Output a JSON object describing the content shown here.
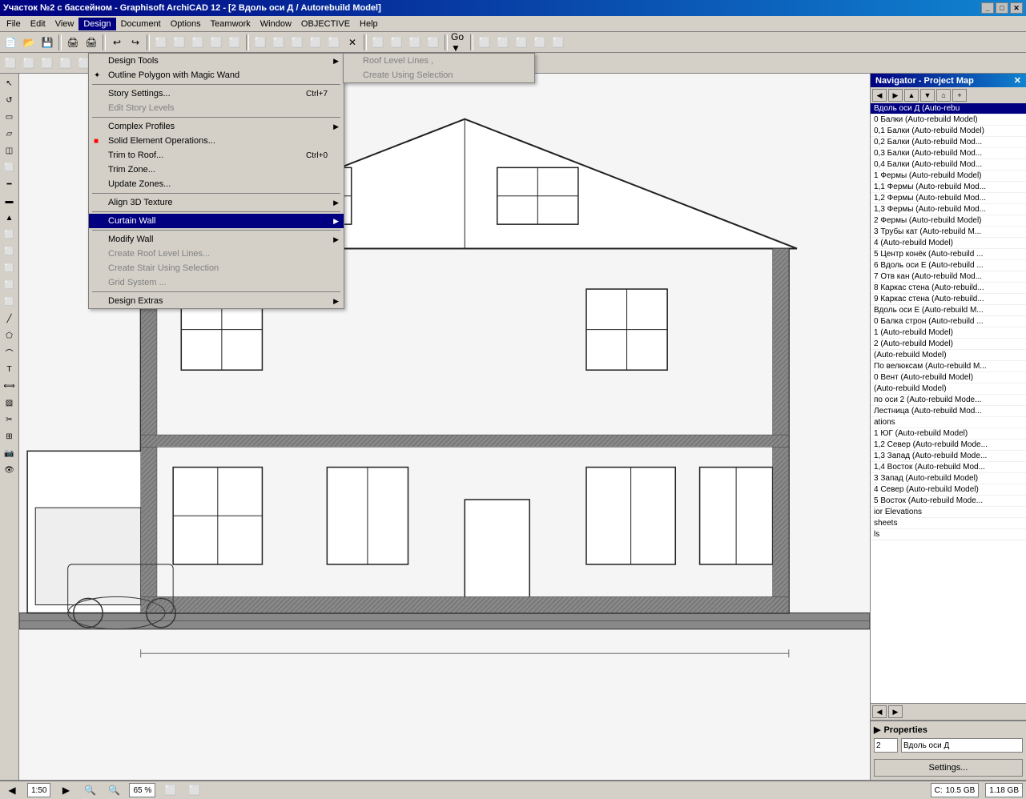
{
  "window": {
    "title": "Участок №2 с бассейном - Graphisoft ArchiCAD 12 - [2 Вдоль оси Д / Autorebuild Model]",
    "title_buttons": [
      "_",
      "□",
      "✕"
    ]
  },
  "menubar": {
    "items": [
      "File",
      "Edit",
      "View",
      "Design",
      "Document",
      "Options",
      "Teamwork",
      "Window",
      "OBJECTIVE",
      "Help"
    ]
  },
  "design_menu": {
    "items": [
      {
        "label": "Design Tools",
        "has_submenu": true,
        "disabled": false,
        "icon": ""
      },
      {
        "label": "Outline Polygon with Magic Wand",
        "has_submenu": false,
        "disabled": false,
        "icon": "✦"
      },
      {
        "label": "---"
      },
      {
        "label": "Story Settings...",
        "shortcut": "Ctrl+7",
        "has_submenu": false,
        "disabled": false,
        "icon": ""
      },
      {
        "label": "Edit Story Levels",
        "has_submenu": false,
        "disabled": true,
        "icon": ""
      },
      {
        "label": "---"
      },
      {
        "label": "Complex Profiles",
        "has_submenu": true,
        "disabled": false,
        "icon": ""
      },
      {
        "label": "Solid Element Operations...",
        "has_submenu": false,
        "disabled": false,
        "icon": "■"
      },
      {
        "label": "Trim to Roof...",
        "shortcut": "Ctrl+0",
        "has_submenu": false,
        "disabled": false,
        "icon": ""
      },
      {
        "label": "Trim Zone...",
        "has_submenu": false,
        "disabled": false,
        "icon": ""
      },
      {
        "label": "Update Zones...",
        "has_submenu": false,
        "disabled": false,
        "icon": ""
      },
      {
        "label": "---"
      },
      {
        "label": "Align 3D Texture",
        "has_submenu": true,
        "disabled": false,
        "icon": ""
      },
      {
        "label": "---"
      },
      {
        "label": "Curtain Wall",
        "has_submenu": true,
        "disabled": false,
        "icon": "",
        "hovered": true
      },
      {
        "label": "---"
      },
      {
        "label": "Modify Wall",
        "has_submenu": true,
        "disabled": false,
        "icon": ""
      },
      {
        "label": "Create Roof Level Lines...",
        "has_submenu": false,
        "disabled": true,
        "icon": ""
      },
      {
        "label": "Create Stair Using Selection",
        "has_submenu": false,
        "disabled": true,
        "icon": ""
      },
      {
        "label": "Grid System ...",
        "has_submenu": false,
        "disabled": true,
        "icon": ""
      },
      {
        "label": "---"
      },
      {
        "label": "Design Extras",
        "has_submenu": true,
        "disabled": false,
        "icon": ""
      }
    ]
  },
  "curtain_wall_submenu": {
    "items": [
      {
        "label": "Roof Level Lines   ,",
        "disabled": true
      },
      {
        "label": "Create Using Selection",
        "disabled": true
      }
    ]
  },
  "navigator": {
    "title": "Navigator - Project Map",
    "items": [
      "Вдоль оси Д (Auto-rebu",
      "0 Балки (Auto-rebuild Model)",
      "0,1 Балки (Auto-rebuild Model)",
      "0,2 Балки (Auto-rebuild Mod...",
      "0,3 Балки (Auto-rebuild Mod...",
      "0,4 Балки (Auto-rebuild Mod...",
      "1 Фермы (Auto-rebuild Model)",
      "1,1 Фермы (Auto-rebuild Mod...",
      "1,2 Фермы (Auto-rebuild Mod...",
      "1,3 Фермы (Auto-rebuild Mod...",
      "2 Фермы (Auto-rebuild Model)",
      "3 Трубы кат (Auto-rebuild M...",
      "4 (Auto-rebuild Model)",
      "5 Центр конёк (Auto-rebuild ...",
      "6 Вдоль оси Е (Auto-rebuild ...",
      "7 Отв кан (Auto-rebuild Mod...",
      "8 Каркас стена (Auto-rebuild...",
      "9 Каркас стена (Auto-rebuild...",
      "Вдоль оси Е (Auto-rebuild M...",
      "0 Балка строн (Auto-rebuild ...",
      "1 (Auto-rebuild Model)",
      "2 (Auto-rebuild Model)",
      "(Auto-rebuild Model)",
      "По велюксам (Auto-rebuild M...",
      "0 Вент (Auto-rebuild Model)",
      "(Auto-rebuild Model)",
      "по оси 2 (Auto-rebuild Mode...",
      "Лестница (Auto-rebuild Mod...",
      "ations",
      "1 ЮГ (Auto-rebuild Model)",
      "1,2 Север (Auto-rebuild Mode...",
      "1,3 Запад (Auto-rebuild Mode...",
      "1,4 Восток (Auto-rebuild Mod...",
      "3 Запад (Auto-rebuild Model)",
      "4 Север (Auto-rebuild Model)",
      "5 Восток (Auto-rebuild Mode...",
      "ior Elevations",
      "sheets",
      "ls"
    ],
    "selected_item": "Вдоль оси Д (Auto-rebu"
  },
  "properties": {
    "title": "Properties",
    "field_value": "2",
    "field_label": "Вдоль оси Д",
    "settings_btn": "Settings..."
  },
  "statusbar": {
    "story": "1:50",
    "zoom": "65 %",
    "memory": "C: 10.5 GB",
    "disk": "1.18 GB"
  }
}
